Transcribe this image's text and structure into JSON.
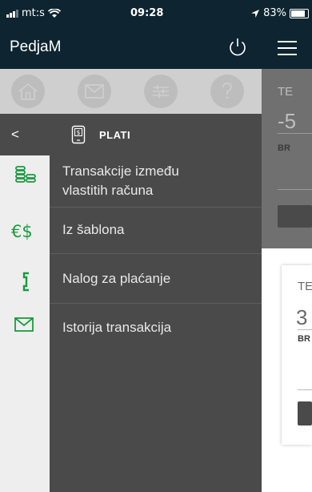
{
  "status_bar": {
    "carrier": "mt:s",
    "time": "09:28",
    "battery": "83%",
    "battery_level": 0.83
  },
  "header": {
    "username": "PedjaM"
  },
  "section": {
    "title": "PLATI",
    "back_glyph": "<"
  },
  "menu": {
    "items": [
      {
        "line1": "Transakcije između",
        "line2": "vlastitih računa",
        "icon": "coins-icon"
      },
      {
        "line1": "Iz šablona",
        "icon": "currency-exchange-icon"
      },
      {
        "line1": "Nalog za plaćanje",
        "icon": "payment-order-icon"
      },
      {
        "line1": "Istorija transakcija",
        "icon": "envelope-icon"
      }
    ]
  },
  "background_page": {
    "card1": {
      "label": "TE",
      "value": "-5",
      "sub": "BR"
    },
    "card2": {
      "label": "TE",
      "value": "3",
      "sub": "BR"
    }
  },
  "colors": {
    "header_bg": "#0e2430",
    "menu_bg": "#4a4a4a",
    "accent_green": "#1a9b3e",
    "rail_bg": "#eeeeee"
  }
}
